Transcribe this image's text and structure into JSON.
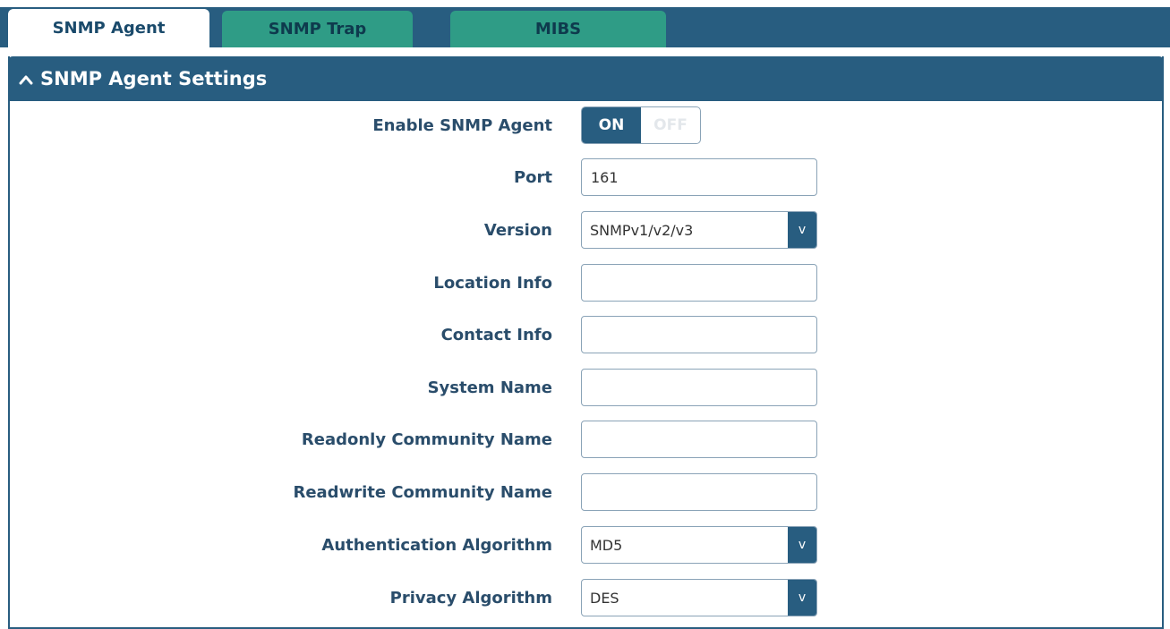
{
  "tabs": [
    {
      "label": "SNMP Agent",
      "active": true
    },
    {
      "label": "SNMP Trap",
      "active": false
    },
    {
      "label": "MIBS",
      "active": false
    }
  ],
  "panel": {
    "title": "SNMP Agent Settings",
    "collapse_icon": "chevron-up-icon"
  },
  "fields": {
    "enable_snmp_agent": {
      "label": "Enable SNMP Agent",
      "on_label": "ON",
      "off_label": "OFF",
      "state": "ON"
    },
    "port": {
      "label": "Port",
      "value": "161"
    },
    "version": {
      "label": "Version",
      "value": "SNMPv1/v2/v3"
    },
    "location_info": {
      "label": "Location Info",
      "value": ""
    },
    "contact_info": {
      "label": "Contact Info",
      "value": ""
    },
    "system_name": {
      "label": "System Name",
      "value": ""
    },
    "readonly_community_name": {
      "label": "Readonly Community Name",
      "value": ""
    },
    "readwrite_community_name": {
      "label": "Readwrite Community Name",
      "value": ""
    },
    "authentication_algorithm": {
      "label": "Authentication Algorithm",
      "value": "MD5"
    },
    "privacy_algorithm": {
      "label": "Privacy Algorithm",
      "value": "DES"
    }
  },
  "dropdown_arrow_glyph": "v",
  "colors": {
    "header_blue": "#285d80",
    "tab_inactive": "#2f9c86",
    "label_text": "#2a4d6b"
  }
}
